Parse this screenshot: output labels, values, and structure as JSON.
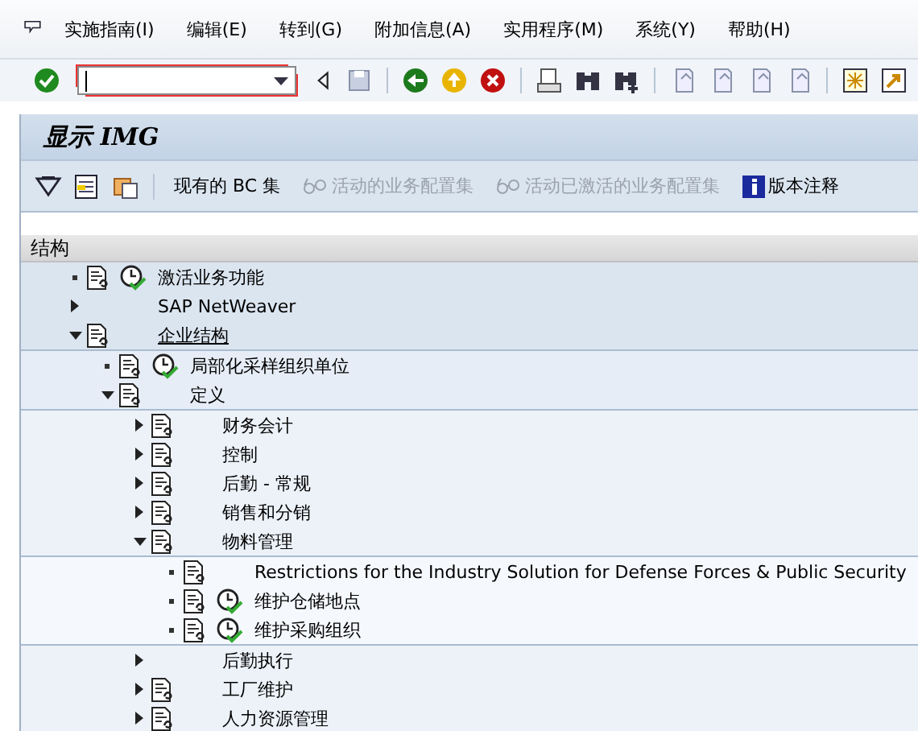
{
  "menu_bar": {
    "items": [
      "实施指南(I)",
      "编辑(E)",
      "转到(G)",
      "附加信息(A)",
      "实用程序(M)",
      "系统(Y)",
      "帮助(H)"
    ]
  },
  "title": "显示 IMG",
  "app_toolbar": {
    "buttons": [
      {
        "label": "现有的 BC 集",
        "kind": "text",
        "disabled": false
      },
      {
        "label": "活动的业务配置集",
        "kind": "glasses",
        "disabled": true
      },
      {
        "label": "活动已激活的业务配置集",
        "kind": "glasses",
        "disabled": true
      },
      {
        "label": "版本注释",
        "kind": "info",
        "disabled": false
      }
    ]
  },
  "tree": {
    "header": "结构",
    "nodes": [
      {
        "label": "激活业务功能",
        "document": true,
        "clock": true,
        "current": false
      },
      {
        "label": "SAP NetWeaver",
        "document": false,
        "clock": false,
        "expanded": false,
        "current": false
      },
      {
        "label": "企业结构",
        "document": true,
        "clock": false,
        "expanded": true,
        "current": true,
        "children": [
          {
            "label": "局部化采样组织单位",
            "document": true,
            "clock": true,
            "current": false
          },
          {
            "label": "定义",
            "document": true,
            "clock": false,
            "expanded": true,
            "current": false,
            "children": [
              {
                "label": "财务会计",
                "document": true,
                "clock": false,
                "expanded": false,
                "current": false
              },
              {
                "label": "控制",
                "document": true,
                "clock": false,
                "expanded": false,
                "current": false
              },
              {
                "label": "后勤 - 常规",
                "document": true,
                "clock": false,
                "expanded": false,
                "current": false
              },
              {
                "label": "销售和分销",
                "document": true,
                "clock": false,
                "expanded": false,
                "current": false
              },
              {
                "label": "物料管理",
                "document": true,
                "clock": false,
                "expanded": true,
                "current": false,
                "children": [
                  {
                    "label": "Restrictions for the Industry Solution for Defense Forces & Public Security",
                    "document": true,
                    "clock": false,
                    "current": false
                  },
                  {
                    "label": "维护仓储地点",
                    "document": true,
                    "clock": true,
                    "current": false
                  },
                  {
                    "label": "维护采购组织",
                    "document": true,
                    "clock": true,
                    "current": false
                  }
                ]
              },
              {
                "label": "后勤执行",
                "document": false,
                "clock": false,
                "expanded": false,
                "current": false
              },
              {
                "label": "工厂维护",
                "document": true,
                "clock": false,
                "expanded": false,
                "current": false
              },
              {
                "label": "人力资源管理",
                "document": true,
                "clock": false,
                "expanded": false,
                "current": false
              }
            ]
          }
        ]
      }
    ]
  }
}
